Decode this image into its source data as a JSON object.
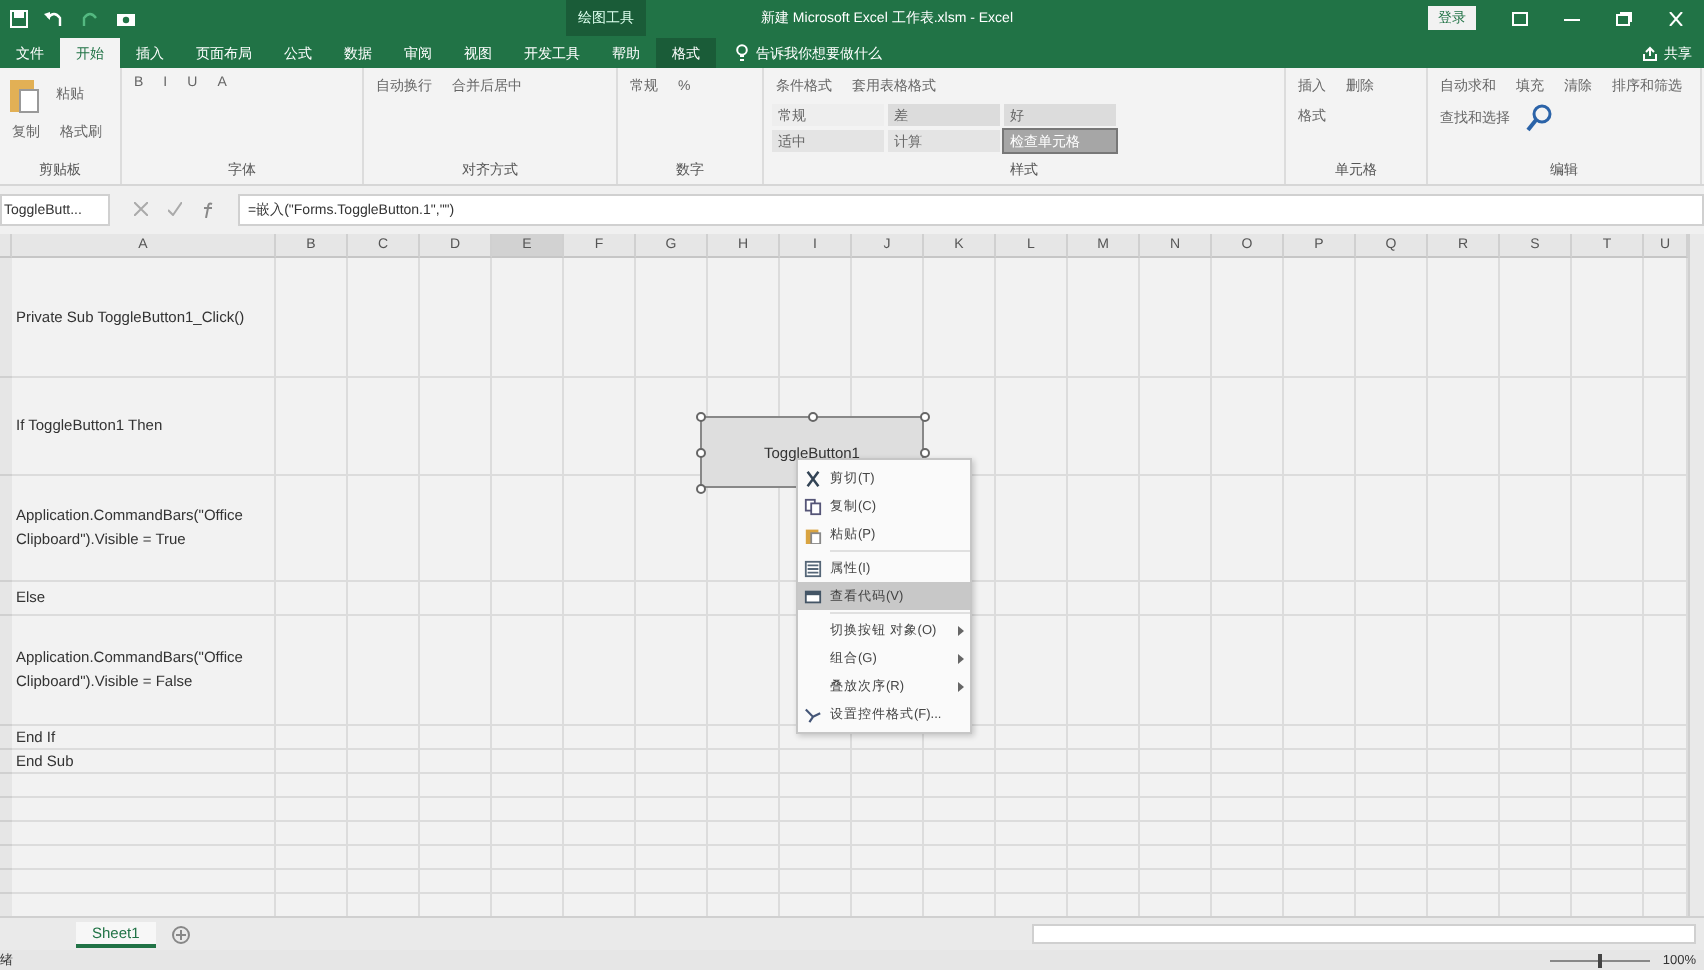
{
  "title_bar": {
    "context": "绘图工具",
    "title": "新建 Microsoft Excel 工作表.xlsm - Excel",
    "login": "登录"
  },
  "ribbon_tabs": [
    {
      "label": "文件",
      "selected": false
    },
    {
      "label": "开始",
      "selected": true
    },
    {
      "label": "插入",
      "selected": false
    },
    {
      "label": "页面布局",
      "selected": false
    },
    {
      "label": "公式",
      "selected": false
    },
    {
      "label": "数据",
      "selected": false
    },
    {
      "label": "审阅",
      "selected": false
    },
    {
      "label": "视图",
      "selected": false
    },
    {
      "label": "开发工具",
      "selected": false
    },
    {
      "label": "帮助",
      "selected": false
    },
    {
      "label": "格式",
      "selected": false,
      "kind": "context"
    }
  ],
  "tell_me": "告诉我你想要做什么",
  "share": "共享",
  "ribbon_groups": [
    {
      "label": "剪贴板",
      "items": [
        "粘贴",
        "复制",
        "格式刷"
      ]
    },
    {
      "label": "字体",
      "items": [
        "B",
        "I",
        "U",
        "A"
      ]
    },
    {
      "label": "对齐方式",
      "items": [
        "自动换行",
        "合并后居中"
      ]
    },
    {
      "label": "数字",
      "items": [
        "常规",
        "%"
      ]
    },
    {
      "label": "样式",
      "items": [
        "条件格式",
        "套用表格格式"
      ],
      "styles": [
        {
          "label": "常规",
          "color": "#eeeeee"
        },
        {
          "label": "差",
          "color": "#dcdcdc"
        },
        {
          "label": "好",
          "color": "#dcdcdc"
        },
        {
          "label": "适中",
          "color": "#e4e4e4"
        },
        {
          "label": "计算",
          "color": "#e4e4e4"
        },
        {
          "label": "检查单元格",
          "color": "#a6a6a6"
        }
      ]
    },
    {
      "label": "单元格",
      "items": [
        "插入",
        "删除",
        "格式"
      ]
    },
    {
      "label": "编辑",
      "items": [
        "自动求和",
        "填充",
        "清除",
        "排序和筛选",
        "查找和选择"
      ]
    }
  ],
  "formula_bar": {
    "name_box": "ToggleButt...",
    "formula": "=嵌入(\"Forms.ToggleButton.1\",\"\")"
  },
  "sheet": {
    "columns": [
      {
        "label": "A",
        "selected": false
      },
      {
        "label": "B",
        "selected": false
      },
      {
        "label": "C",
        "selected": false
      },
      {
        "label": "D",
        "selected": false
      },
      {
        "label": "E",
        "selected": true
      },
      {
        "label": "F",
        "selected": false
      },
      {
        "label": "G",
        "selected": false
      },
      {
        "label": "H",
        "selected": false
      },
      {
        "label": "I",
        "selected": false
      },
      {
        "label": "J",
        "selected": false
      },
      {
        "label": "K",
        "selected": false
      },
      {
        "label": "L",
        "selected": false
      },
      {
        "label": "M",
        "selected": false
      },
      {
        "label": "N",
        "selected": false
      },
      {
        "label": "O",
        "selected": false
      },
      {
        "label": "P",
        "selected": false
      },
      {
        "label": "Q",
        "selected": false
      },
      {
        "label": "R",
        "selected": false
      },
      {
        "label": "S",
        "selected": false
      },
      {
        "label": "T",
        "selected": false
      },
      {
        "label": "U",
        "selected": false
      }
    ],
    "rows": [
      {
        "a": "Private Sub ToggleButton1_Click()"
      },
      {
        "a": "If ToggleButton1 Then"
      },
      {
        "a": "Application.CommandBars(\"Office Clipboard\").Visible = True"
      },
      {
        "a": "Else"
      },
      {
        "a": "Application.CommandBars(\"Office Clipboard\").Visible = False"
      },
      {
        "a": "End If"
      },
      {
        "a": "End Sub"
      }
    ]
  },
  "toggle_button": {
    "label": "ToggleButton1",
    "selected": true
  },
  "context_menu": [
    {
      "label": "剪切(T)",
      "kind": "command",
      "selected": false
    },
    {
      "label": "复制(C)",
      "kind": "command",
      "selected": false
    },
    {
      "label": "粘贴(P)",
      "kind": "command",
      "selected": false
    },
    {
      "label": "属性(I)",
      "kind": "command",
      "selected": false
    },
    {
      "label": "查看代码(V)",
      "kind": "command",
      "selected": true
    },
    {
      "label": "切换按钮 对象(O)",
      "kind": "submenu",
      "selected": false
    },
    {
      "label": "组合(G)",
      "kind": "submenu",
      "selected": false
    },
    {
      "label": "叠放次序(R)",
      "kind": "submenu",
      "selected": false
    },
    {
      "label": "设置控件格式(F)...",
      "kind": "command",
      "selected": false
    }
  ],
  "sheet_tabs": [
    {
      "label": "Sheet1",
      "selected": true
    }
  ],
  "status_bar": {
    "status": "绪",
    "zoom": "100%",
    "zoom_slider": {
      "level": 0.5
    }
  }
}
